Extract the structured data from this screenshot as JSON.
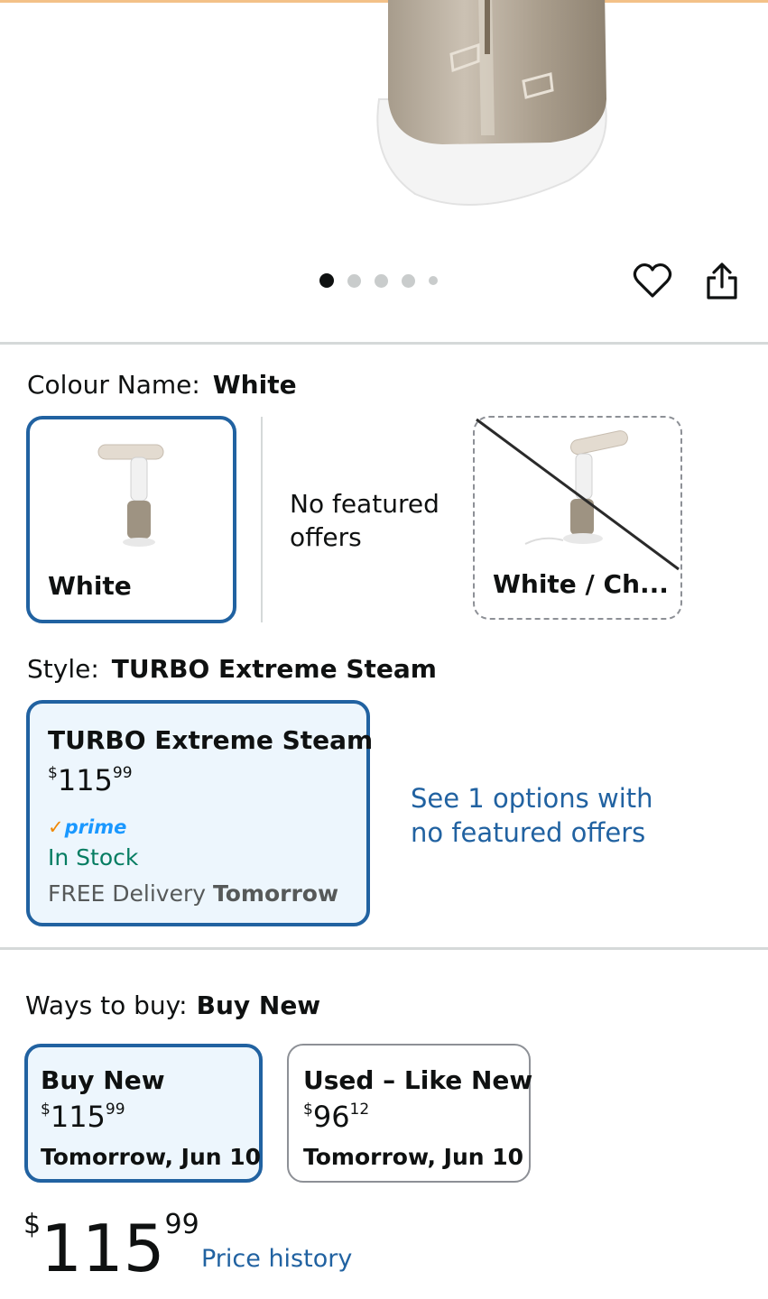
{
  "gallery": {
    "image_alt": "Garment steamer product image",
    "dots_count": 5,
    "active_dot": 0,
    "favorite_icon": "heart-icon",
    "share_icon": "share-icon"
  },
  "colour": {
    "label": "Colour Name:",
    "selected": "White",
    "options": [
      {
        "name": "White",
        "state": "selected"
      },
      {
        "name": "No featured offers",
        "state": "unavailable-text"
      },
      {
        "name": "White / Ch...",
        "state": "unavailable"
      }
    ]
  },
  "style": {
    "label": "Style:",
    "selected": "TURBO Extreme Steam",
    "card": {
      "title": "TURBO Extreme Steam",
      "currency": "$",
      "whole": "115",
      "fraction": "99",
      "prime_check": "✓",
      "prime": "prime",
      "stock": "In Stock",
      "delivery_prefix": "FREE Delivery",
      "delivery_day": "Tomorrow"
    },
    "see_options": "See 1 options with no featured offers"
  },
  "ways_to_buy": {
    "label": "Ways to buy:",
    "selected": "Buy New",
    "options": [
      {
        "title": "Buy New",
        "currency": "$",
        "whole": "115",
        "fraction": "99",
        "date": "Tomorrow, Jun 10"
      },
      {
        "title": "Used – Like New",
        "currency": "$",
        "whole": "96",
        "fraction": "12",
        "date": "Tomorrow, Jun 10"
      }
    ]
  },
  "price": {
    "currency": "$",
    "whole": "115",
    "fraction": "99",
    "history_link": "Price history"
  },
  "colors": {
    "accent_border": "#2162a1",
    "selected_bg": "#edf6fd",
    "link": "#2162a1",
    "in_stock": "#067d62",
    "prime_blue": "#1a98ff",
    "prime_orange": "#f08804"
  }
}
